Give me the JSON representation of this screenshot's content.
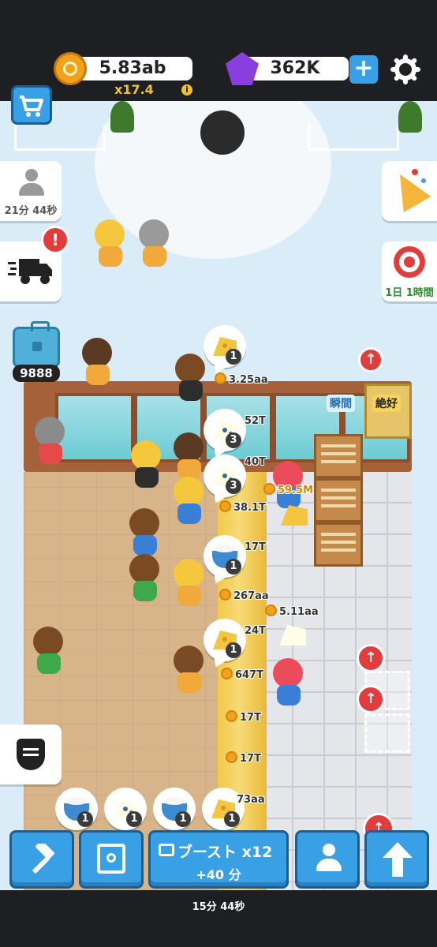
{
  "hud": {
    "coins": "5.83ab",
    "multiplier": "x17.4",
    "info_icon": "i",
    "gems": "362K",
    "plus_label": "+",
    "colors": {
      "coin": "#f1a21c",
      "gem": "#8a3ee0",
      "accent": "#3aa0e6"
    }
  },
  "side_left": {
    "customer_timer": "21分 44秒",
    "delivery_badge": "!",
    "toolbox_count": "9888"
  },
  "side_right": {
    "event_timer": "1日 1時間"
  },
  "world": {
    "price_labels": [
      "3.25aa",
      "52T",
      "40T",
      "38.1T",
      "59.5M",
      "17T",
      "267aa",
      "5.11aa",
      "24T",
      "647T",
      "17T",
      "17T",
      "73aa"
    ],
    "bubble_counts": [
      "1",
      "3",
      "3",
      "1",
      "1",
      "1",
      "1",
      "1",
      "1"
    ],
    "tag_instant": "瞬間",
    "tag_excellent": "絶好",
    "up_arrow": "↑"
  },
  "bottom": {
    "boost_label": "ブースト x12",
    "boost_sub": "+40 分",
    "footer_timer": "15分 44秒"
  },
  "icons": [
    "coin-icon",
    "gem-icon",
    "settings-gear-icon",
    "shop-cart-icon",
    "person-icon",
    "truck-icon",
    "toolbox-icon",
    "party-popper-icon",
    "target-icon",
    "burger-icon",
    "hammer-icon",
    "safe-icon",
    "ad-icon",
    "manager-person-icon",
    "upgrade-arrow-icon"
  ]
}
